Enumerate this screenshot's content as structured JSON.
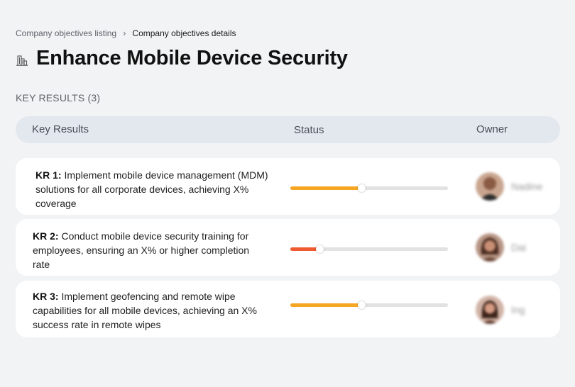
{
  "breadcrumb": {
    "parent": "Company objectives listing",
    "separator": "›",
    "current": "Company objectives details"
  },
  "page": {
    "title_icon": "building-icon",
    "title": "Enhance Mobile Device Security"
  },
  "key_results_section": {
    "label": "KEY RESULTS (3)"
  },
  "table": {
    "columns": [
      "Key Results",
      "Status",
      "Owner"
    ],
    "rows": [
      {
        "kr_label": "KR 1:",
        "text": "Implement mobile device management (MDM) solutions for all corporate devices, achieving X% coverage",
        "progress": 0.45,
        "progress_color": "#f6a623",
        "owner": "Nadine"
      },
      {
        "kr_label": "KR 2:",
        "text": "Conduct mobile device security training for employees, ensuring an X% or higher completion rate",
        "progress": 0.185,
        "progress_color": "#ef5a30",
        "owner": "Dai"
      },
      {
        "kr_label": "KR 3:",
        "text": "Implement geofencing and remote wipe capabilities for all mobile devices, achieving an X% success rate in remote wipes",
        "progress": 0.45,
        "progress_color": "#f6a623",
        "owner": "Ing"
      }
    ]
  }
}
